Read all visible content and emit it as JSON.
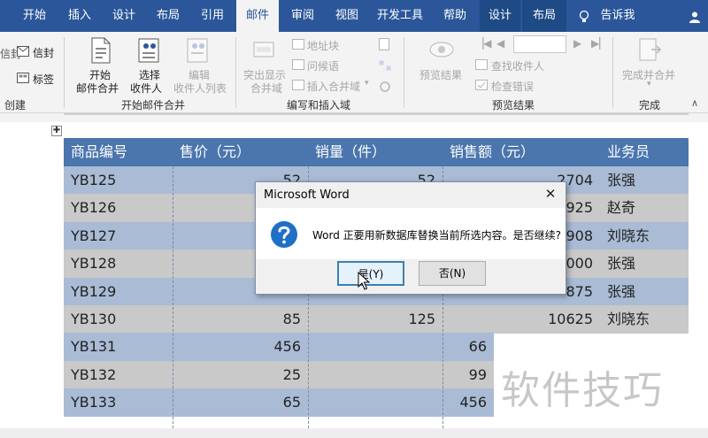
{
  "tabs": {
    "start": "开始",
    "insert": "插入",
    "design": "设计",
    "layout": "布局",
    "references": "引用",
    "mailings": "邮件",
    "review": "审阅",
    "view": "视图",
    "developer": "开发工具",
    "help": "帮助",
    "table_design": "设计",
    "table_layout": "布局",
    "tell_me": "告诉我"
  },
  "ribbon": {
    "create": {
      "envelopes": "信封",
      "labels": "标签",
      "partial": "信封",
      "group": "创建"
    },
    "start_merge": {
      "start_btn_l1": "开始",
      "start_btn_l2": "邮件合并",
      "select_l1": "选择",
      "select_l2": "收件人",
      "edit_l1": "编辑",
      "edit_l2": "收件人列表",
      "group": "开始邮件合并"
    },
    "write_insert": {
      "highlight_l1": "突出显示",
      "highlight_l2": "合并域",
      "address_block": "地址块",
      "greeting_line": "问候语",
      "insert_merge_field": "插入合并域",
      "group": "编写和插入域"
    },
    "preview": {
      "preview_results": "预览结果",
      "find_recipient": "查找收件人",
      "check_errors": "检查错误",
      "group": "预览结果"
    },
    "finish": {
      "finish_merge": "完成并合并",
      "group": "完成"
    }
  },
  "table": {
    "headers": [
      "商品编号",
      "售价（元）",
      "销量（件）",
      "销售额（元）",
      "业务员"
    ],
    "rows": [
      [
        "YB125",
        "52",
        "52",
        "2704",
        "张强"
      ],
      [
        "YB126",
        "",
        "",
        "925",
        "赵奇"
      ],
      [
        "YB127",
        "",
        "",
        "908",
        "刘晓东"
      ],
      [
        "YB128",
        "",
        "",
        "000",
        "张强"
      ],
      [
        "YB129",
        "",
        "",
        "875",
        "张强"
      ],
      [
        "YB130",
        "85",
        "125",
        "10625",
        "刘晓东"
      ],
      [
        "YB131",
        "456",
        "66",
        "",
        ""
      ],
      [
        "YB132",
        "25",
        "99",
        "",
        ""
      ],
      [
        "YB133",
        "65",
        "456",
        "",
        ""
      ]
    ]
  },
  "dialog": {
    "title": "Microsoft Word",
    "message": "Word 正要用新数据库替换当前所选内容。是否继续?",
    "yes": "是(Y)",
    "no": "否(N)"
  },
  "watermark": "软件技巧",
  "colors": {
    "tabbar": "#2b579a",
    "header_row": "#4a75ad",
    "row_blue": "#a9bbd5",
    "row_gray": "#c9c9c9",
    "question_icon": "#1f6fc5"
  }
}
